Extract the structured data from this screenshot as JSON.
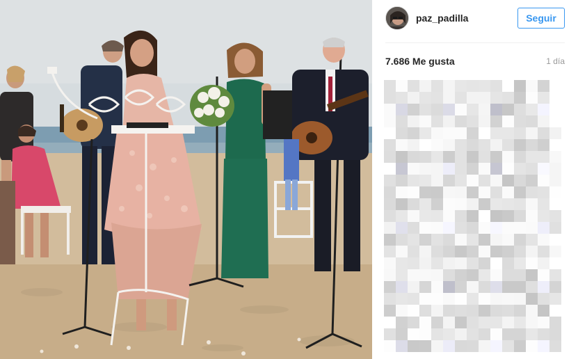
{
  "post": {
    "username": "paz_padilla",
    "follow_label": "Seguir",
    "likes_text": "7.686 Me gusta",
    "time_ago": "1 día"
  },
  "photo": {
    "description_icon": "photo-beach-ceremony"
  },
  "colors": {
    "accent": "#3897f0",
    "text": "#262626",
    "muted": "#999999",
    "divider": "#efefef"
  }
}
